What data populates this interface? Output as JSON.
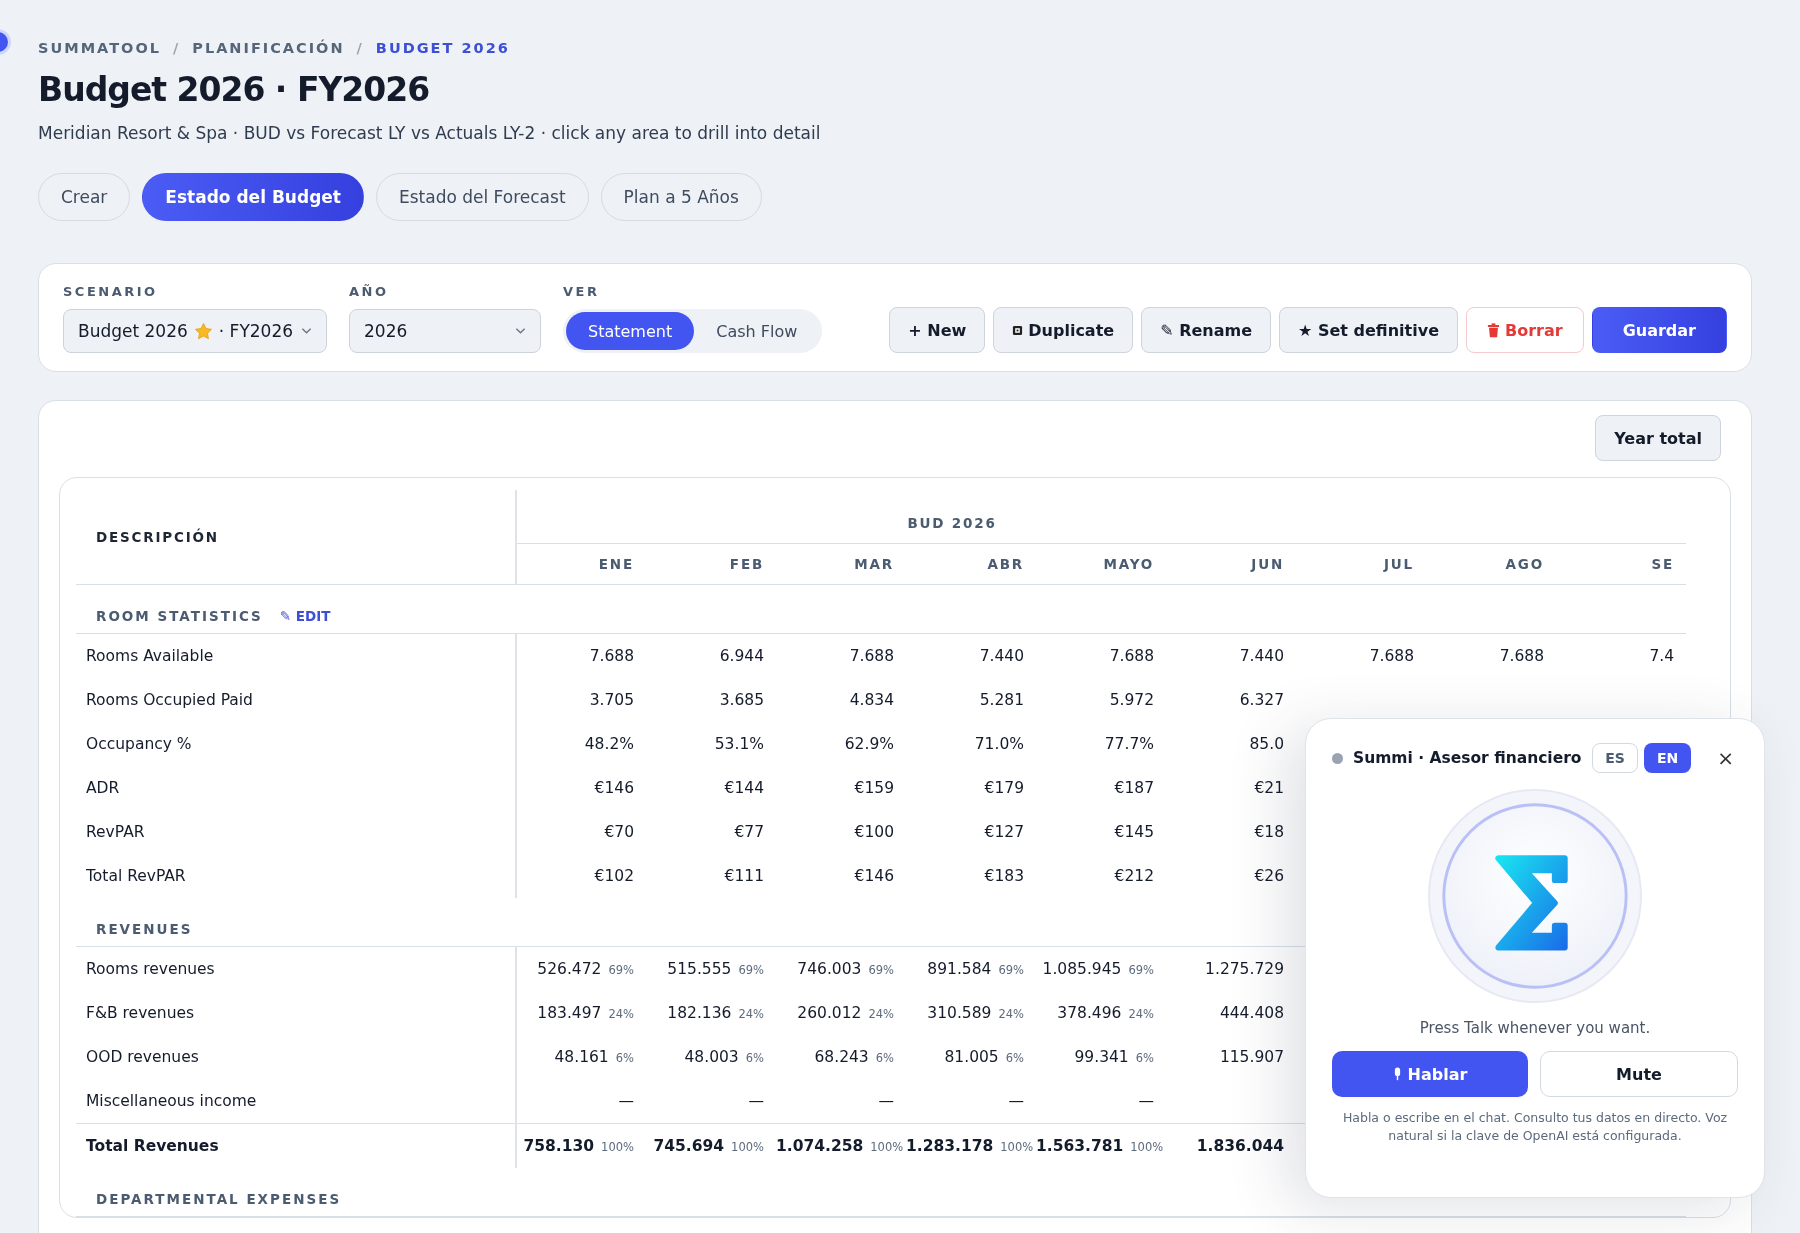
{
  "breadcrumb": [
    {
      "label": "SUMMATOOL",
      "current": false
    },
    {
      "label": "PLANIFICACIÓN",
      "current": false
    },
    {
      "label": "BUDGET 2026",
      "current": true
    }
  ],
  "breadcrumb_separator": "/",
  "title": "Budget 2026 · FY2026",
  "subtitle": "Meridian Resort & Spa · BUD vs Forecast LY vs Actuals LY-2 · click any area to drill into detail",
  "tabs": [
    {
      "label": "Crear",
      "selected": false
    },
    {
      "label": "Estado del Budget",
      "selected": true
    },
    {
      "label": "Estado del Forecast",
      "selected": false
    },
    {
      "label": "Plan a 5 Años",
      "selected": false
    }
  ],
  "controls": {
    "scenario": {
      "label": "SCENARIO",
      "value_before": "Budget 2026",
      "value_after": "· FY2026",
      "starred": true
    },
    "year": {
      "label": "AÑO",
      "value": "2026"
    },
    "view": {
      "label": "VER",
      "options": [
        {
          "label": "Statement",
          "selected": true
        },
        {
          "label": "Cash Flow",
          "selected": false
        }
      ]
    },
    "actions": [
      {
        "label": "+ New",
        "kind": "plain"
      },
      {
        "label": "Duplicate",
        "kind": "duplicate"
      },
      {
        "label": "✎ Rename",
        "kind": "plain"
      },
      {
        "label": "★ Set definitive",
        "kind": "plain"
      },
      {
        "label": "Borrar",
        "kind": "danger"
      },
      {
        "label": "Guardar",
        "kind": "primary"
      }
    ]
  },
  "year_total_button": "Year total",
  "table": {
    "description_header": "DESCRIPCIÓN",
    "group_header": "BUD 2026",
    "columns": [
      "ENE",
      "FEB",
      "MAR",
      "ABR",
      "MAYO",
      "JUN",
      "JUL",
      "AGO",
      "SE"
    ],
    "sections": [
      {
        "title": "ROOM STATISTICS",
        "edit_link": "✎ EDIT",
        "rows": [
          {
            "label": "Rooms Available",
            "total": false,
            "cells": [
              {
                "value": "7.688"
              },
              {
                "value": "6.944"
              },
              {
                "value": "7.688"
              },
              {
                "value": "7.440"
              },
              {
                "value": "7.688"
              },
              {
                "value": "7.440"
              },
              {
                "value": "7.688"
              },
              {
                "value": "7.688"
              },
              {
                "value": "7.4"
              }
            ]
          },
          {
            "label": "Rooms Occupied Paid",
            "total": false,
            "cells": [
              {
                "value": "3.705"
              },
              {
                "value": "3.685"
              },
              {
                "value": "4.834"
              },
              {
                "value": "5.281"
              },
              {
                "value": "5.972"
              },
              {
                "value": "6.327"
              },
              null,
              null,
              null
            ]
          },
          {
            "label": "Occupancy %",
            "total": false,
            "cells": [
              {
                "value": "48.2%"
              },
              {
                "value": "53.1%"
              },
              {
                "value": "62.9%"
              },
              {
                "value": "71.0%"
              },
              {
                "value": "77.7%"
              },
              {
                "value": "85.0"
              },
              null,
              null,
              null
            ]
          },
          {
            "label": "ADR",
            "total": false,
            "cells": [
              {
                "value": "€146"
              },
              {
                "value": "€144"
              },
              {
                "value": "€159"
              },
              {
                "value": "€179"
              },
              {
                "value": "€187"
              },
              {
                "value": "€21"
              },
              null,
              null,
              null
            ]
          },
          {
            "label": "RevPAR",
            "total": false,
            "cells": [
              {
                "value": "€70"
              },
              {
                "value": "€77"
              },
              {
                "value": "€100"
              },
              {
                "value": "€127"
              },
              {
                "value": "€145"
              },
              {
                "value": "€18"
              },
              null,
              null,
              null
            ]
          },
          {
            "label": "Total RevPAR",
            "total": false,
            "cells": [
              {
                "value": "€102"
              },
              {
                "value": "€111"
              },
              {
                "value": "€146"
              },
              {
                "value": "€183"
              },
              {
                "value": "€212"
              },
              {
                "value": "€26"
              },
              null,
              null,
              null
            ]
          }
        ]
      },
      {
        "title": "REVENUES",
        "rows": [
          {
            "label": "Rooms revenues",
            "total": false,
            "cells": [
              {
                "value": "526.472",
                "share": "69%"
              },
              {
                "value": "515.555",
                "share": "69%"
              },
              {
                "value": "746.003",
                "share": "69%"
              },
              {
                "value": "891.584",
                "share": "69%"
              },
              {
                "value": "1.085.945",
                "share": "69%"
              },
              {
                "value": "1.275.729"
              },
              null,
              null,
              null
            ]
          },
          {
            "label": "F&B revenues",
            "total": false,
            "cells": [
              {
                "value": "183.497",
                "share": "24%"
              },
              {
                "value": "182.136",
                "share": "24%"
              },
              {
                "value": "260.012",
                "share": "24%"
              },
              {
                "value": "310.589",
                "share": "24%"
              },
              {
                "value": "378.496",
                "share": "24%"
              },
              {
                "value": "444.408"
              },
              null,
              null,
              null
            ]
          },
          {
            "label": "OOD revenues",
            "total": false,
            "cells": [
              {
                "value": "48.161",
                "share": "6%"
              },
              {
                "value": "48.003",
                "share": "6%"
              },
              {
                "value": "68.243",
                "share": "6%"
              },
              {
                "value": "81.005",
                "share": "6%"
              },
              {
                "value": "99.341",
                "share": "6%"
              },
              {
                "value": "115.907"
              },
              null,
              null,
              null
            ]
          },
          {
            "label": "Miscellaneous income",
            "total": false,
            "cells": [
              {
                "value": "—"
              },
              {
                "value": "—"
              },
              {
                "value": "—"
              },
              {
                "value": "—"
              },
              {
                "value": "—"
              },
              null,
              null,
              null,
              null
            ]
          },
          {
            "label": "Total Revenues",
            "total": true,
            "cells": [
              {
                "value": "758.130",
                "share": "100%"
              },
              {
                "value": "745.694",
                "share": "100%"
              },
              {
                "value": "1.074.258",
                "share": "100%"
              },
              {
                "value": "1.283.178",
                "share": "100%"
              },
              {
                "value": "1.563.781",
                "share": "100%"
              },
              {
                "value": "1.836.044"
              },
              null,
              null,
              null
            ]
          }
        ]
      },
      {
        "title": "DEPARTMENTAL EXPENSES"
      }
    ]
  },
  "assistant": {
    "online": false,
    "title": "Summi · Asesor financiero",
    "languages": [
      {
        "label": "ES",
        "selected": false
      },
      {
        "label": "EN",
        "selected": true
      }
    ],
    "close": "×",
    "hint": "Press Talk whenever you want.",
    "talk_button": "Hablar",
    "mute_button": "Mute",
    "note": "Habla o escribe en el chat. Consulto tus datos en directo. Voz natural si la clave de OpenAI está configurada."
  }
}
